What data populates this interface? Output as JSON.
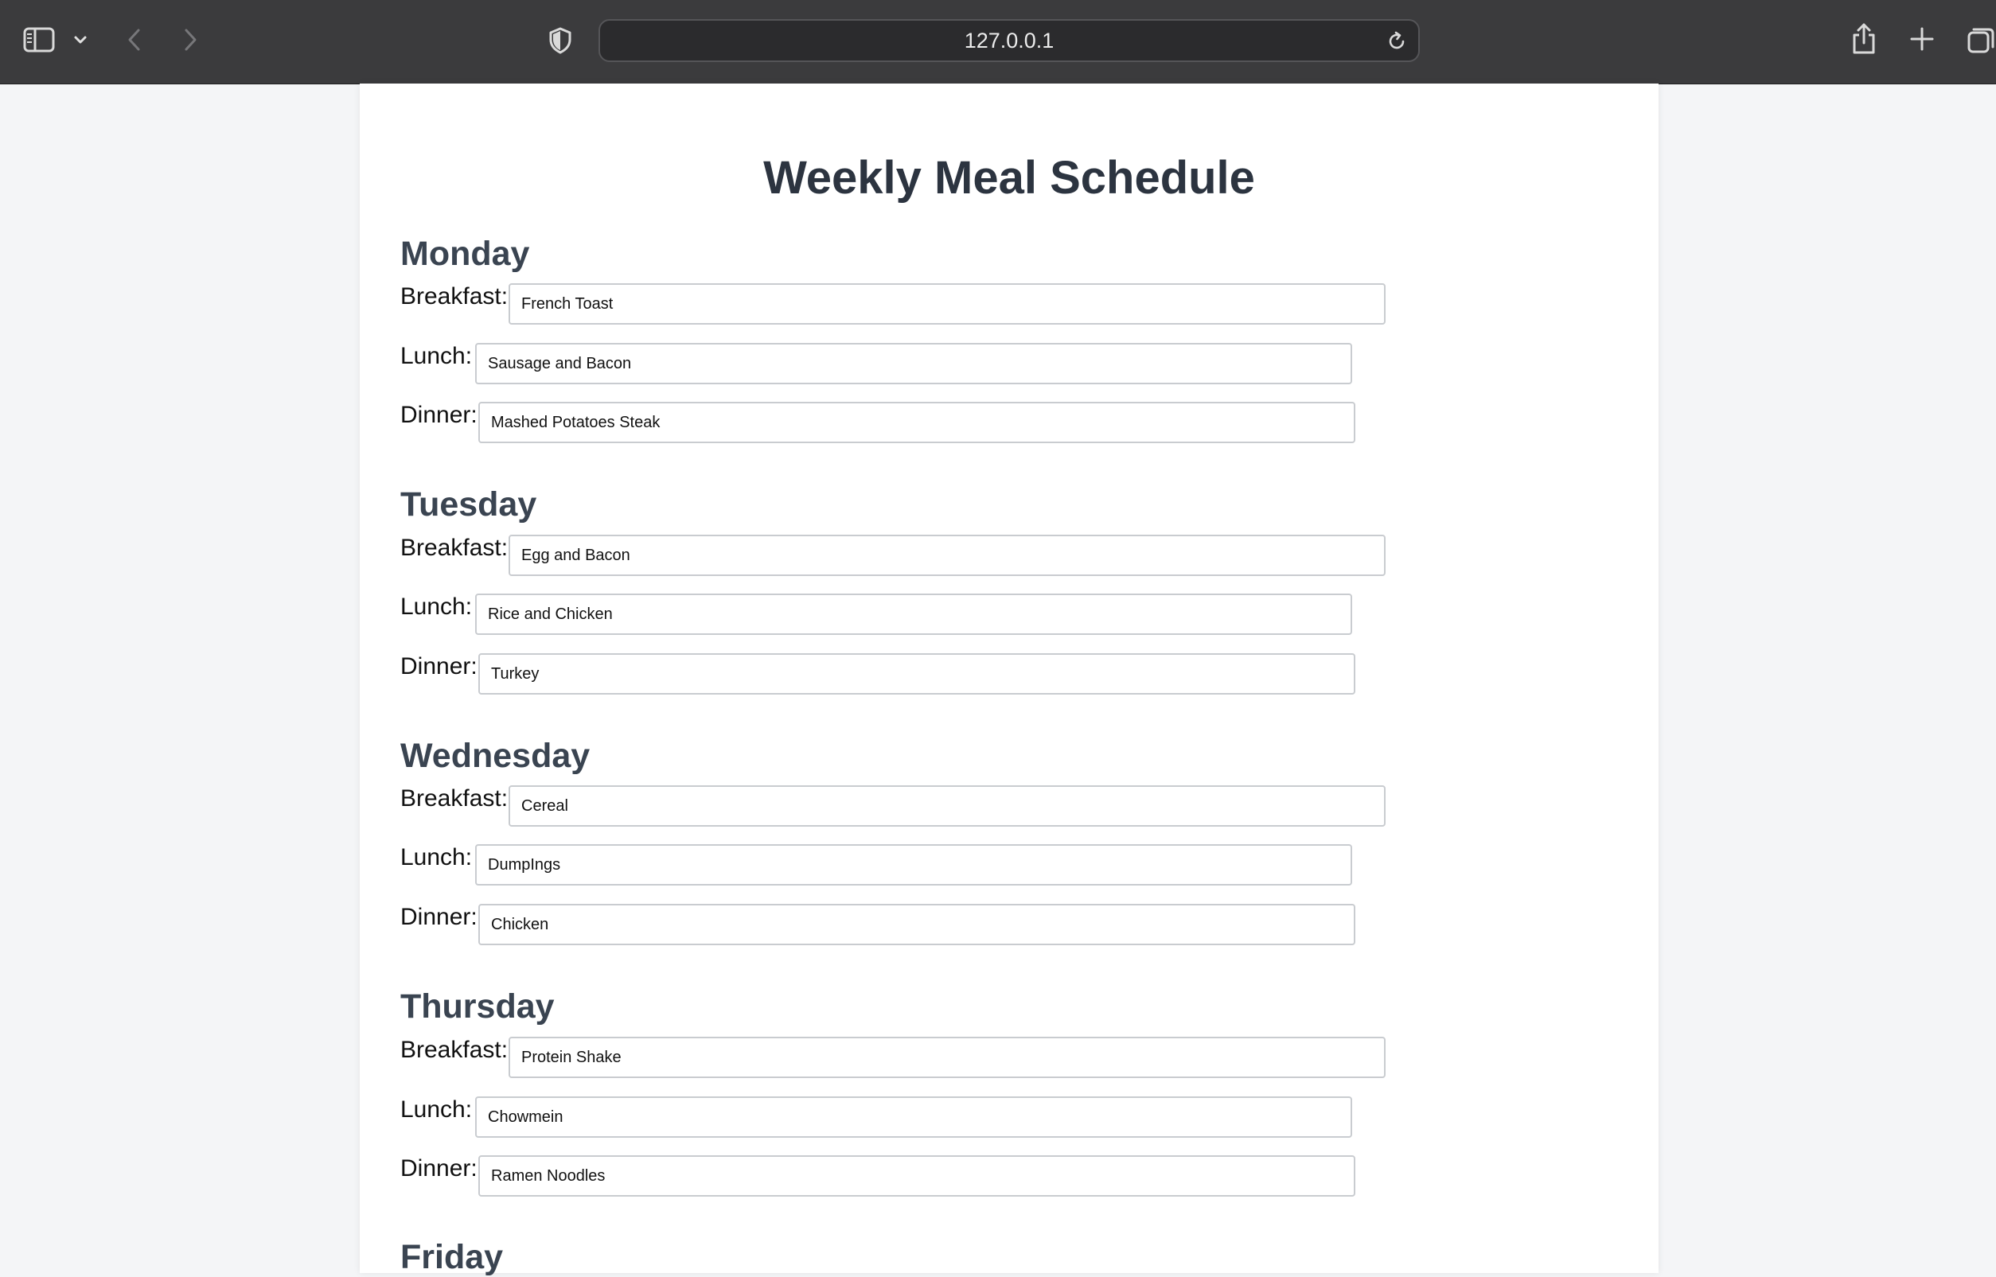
{
  "browser": {
    "address": "127.0.0.1",
    "icons": {
      "sidebar": "sidebar-icon",
      "chevron": "chevron-down-icon",
      "back": "back-arrow-icon",
      "forward": "forward-arrow-icon",
      "privacy": "shield-icon",
      "reload": "reload-icon",
      "share": "share-icon",
      "new_tab": "plus-icon",
      "tabs": "tab-overview-icon"
    }
  },
  "page": {
    "title": "Weekly Meal Schedule",
    "days": [
      {
        "name": "Monday",
        "meals": [
          {
            "label": "Breakfast:",
            "value": "French Toast"
          },
          {
            "label": "Lunch:",
            "value": "Sausage and Bacon"
          },
          {
            "label": "Dinner:",
            "value": "Mashed Potatoes Steak"
          }
        ]
      },
      {
        "name": "Tuesday",
        "meals": [
          {
            "label": "Breakfast:",
            "value": "Egg and Bacon"
          },
          {
            "label": "Lunch:",
            "value": "Rice and Chicken"
          },
          {
            "label": "Dinner:",
            "value": "Turkey"
          }
        ]
      },
      {
        "name": "Wednesday",
        "meals": [
          {
            "label": "Breakfast:",
            "value": "Cereal"
          },
          {
            "label": "Lunch:",
            "value": "DumpIngs"
          },
          {
            "label": "Dinner:",
            "value": "Chicken"
          }
        ]
      },
      {
        "name": "Thursday",
        "meals": [
          {
            "label": "Breakfast:",
            "value": "Protein Shake"
          },
          {
            "label": "Lunch:",
            "value": "Chowmein"
          },
          {
            "label": "Dinner:",
            "value": "Ramen Noodles"
          }
        ]
      },
      {
        "name": "Friday",
        "meals": []
      }
    ]
  }
}
